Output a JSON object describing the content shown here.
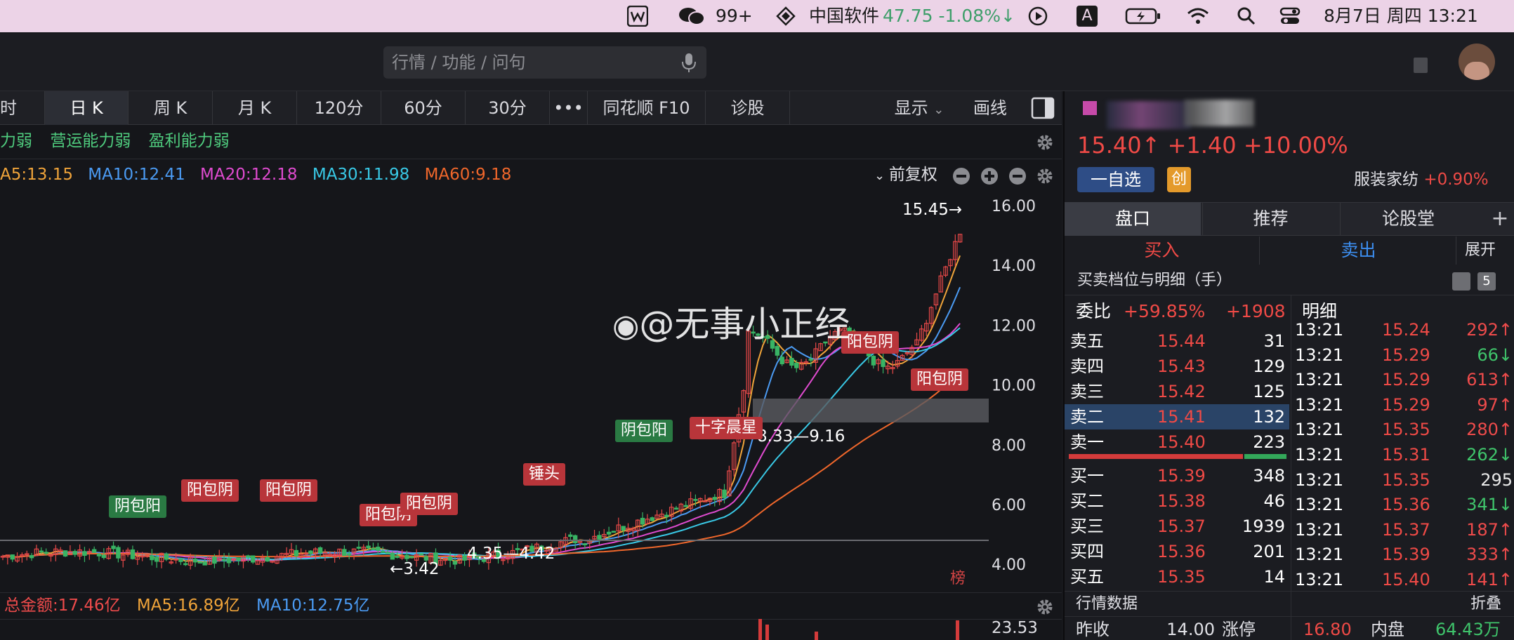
{
  "menubar": {
    "notif_count": "99+",
    "stock_name": "中国软件",
    "stock_quote": "47.75 -1.08%↓",
    "input_badge": "A",
    "datetime": "8月7日 周四  13:21"
  },
  "search": {
    "placeholder": "行情 / 功能 / 问句"
  },
  "toolbar": {
    "tabs": [
      "时",
      "日 K",
      "周 K",
      "月 K",
      "120分",
      "60分",
      "30分",
      "•••",
      "同花顺 F10",
      "诊股"
    ],
    "active": "日 K",
    "display_label": "显示",
    "draw_label": "画线"
  },
  "chart": {
    "tags": [
      "力弱",
      "营运能力弱",
      "盈利能力弱"
    ],
    "ma_line": [
      {
        "label": "A5:13.15",
        "color": "#f0a43a"
      },
      {
        "label": "MA10:12.41",
        "color": "#4b9bf3"
      },
      {
        "label": "MA20:12.18",
        "color": "#e04bd0"
      },
      {
        "label": "MA30:11.98",
        "color": "#39c9e6"
      },
      {
        "label": "MA60:9.18",
        "color": "#f0672b"
      }
    ],
    "adjust_label": "前复权",
    "price_axis": [
      "16.00",
      "14.00",
      "12.00",
      "10.00",
      "8.00",
      "6.00",
      "4.00"
    ],
    "annotations": {
      "high": "15.45→",
      "low": "←3.42",
      "range1": "4.35—4.42",
      "range2": "8.33—9.16"
    },
    "patterns": [
      {
        "label": "阴包阳",
        "color": "#2a7a43"
      },
      {
        "label": "阳包阴",
        "color": "#b8353a"
      },
      {
        "label": "阳包阴",
        "color": "#b8353a"
      },
      {
        "label": "阳包阴",
        "color": "#b8353a"
      },
      {
        "label": "阳包阴",
        "color": "#b8353a"
      },
      {
        "label": "锤头",
        "color": "#b8353a"
      },
      {
        "label": "阴包阳",
        "color": "#2a7a43"
      },
      {
        "label": "十字晨星",
        "color": "#b8353a"
      },
      {
        "label": "阳包阴",
        "color": "#b8353a"
      },
      {
        "label": "阳包阴",
        "color": "#b8353a"
      }
    ],
    "watermark": "@无事小正经",
    "bang_badge": "榜",
    "volume_row": {
      "total": "总金额:17.46亿",
      "ma5": "MA5:16.89亿",
      "ma10": "MA10:12.75亿"
    },
    "volume_axis": "23.53"
  },
  "right_panel": {
    "price_line": "15.40↑ +1.40 +10.00%",
    "watch_label": "一自选",
    "chuang_badge": "创",
    "industry": "服装家纺",
    "industry_change": "+0.90%",
    "tabs": [
      "盘口",
      "推荐",
      "论股堂"
    ],
    "buy_label": "买入",
    "sell_label": "卖出",
    "expand_label": "展开",
    "section_title": "买卖档位与明细（手）",
    "level_badge": "5",
    "weibi_label": "委比",
    "weibi_pct": "+59.85%",
    "weibi_diff": "+1908",
    "detail_label": "明细",
    "asks": [
      {
        "label": "卖五",
        "price": "15.44",
        "vol": "31"
      },
      {
        "label": "卖四",
        "price": "15.43",
        "vol": "129"
      },
      {
        "label": "卖三",
        "price": "15.42",
        "vol": "125"
      },
      {
        "label": "卖二",
        "price": "15.41",
        "vol": "132"
      },
      {
        "label": "卖一",
        "price": "15.40",
        "vol": "223"
      }
    ],
    "bids": [
      {
        "label": "买一",
        "price": "15.39",
        "vol": "348"
      },
      {
        "label": "买二",
        "price": "15.38",
        "vol": "46"
      },
      {
        "label": "买三",
        "price": "15.37",
        "vol": "1939"
      },
      {
        "label": "买四",
        "price": "15.36",
        "vol": "201"
      },
      {
        "label": "买五",
        "price": "15.35",
        "vol": "14"
      }
    ],
    "ticks": [
      {
        "time": "13:21",
        "price": "15.24",
        "vol": "292↑",
        "color": "#ee4b4b"
      },
      {
        "time": "13:21",
        "price": "15.29",
        "vol": "66↓",
        "color": "#3fc46b"
      },
      {
        "time": "13:21",
        "price": "15.29",
        "vol": "613↑",
        "color": "#ee4b4b"
      },
      {
        "time": "13:21",
        "price": "15.29",
        "vol": "97↑",
        "color": "#ee4b4b"
      },
      {
        "time": "13:21",
        "price": "15.35",
        "vol": "280↑",
        "color": "#ee4b4b"
      },
      {
        "time": "13:21",
        "price": "15.31",
        "vol": "262↓",
        "color": "#3fc46b"
      },
      {
        "time": "13:21",
        "price": "15.35",
        "vol": "295",
        "color": "#e8e8e8"
      },
      {
        "time": "13:21",
        "price": "15.36",
        "vol": "341↓",
        "color": "#3fc46b"
      },
      {
        "time": "13:21",
        "price": "15.37",
        "vol": "187↑",
        "color": "#ee4b4b"
      },
      {
        "time": "13:21",
        "price": "15.39",
        "vol": "333↑",
        "color": "#ee4b4b"
      },
      {
        "time": "13:21",
        "price": "15.40",
        "vol": "141↑",
        "color": "#ee4b4b"
      }
    ],
    "market_data_label": "行情数据",
    "collapse_label": "折叠",
    "bottom": {
      "prev_close_label": "昨收",
      "prev_close": "14.00",
      "limit_label": "涨停",
      "limit": "16.80",
      "inner_label": "内盘",
      "inner": "64.43万"
    }
  }
}
